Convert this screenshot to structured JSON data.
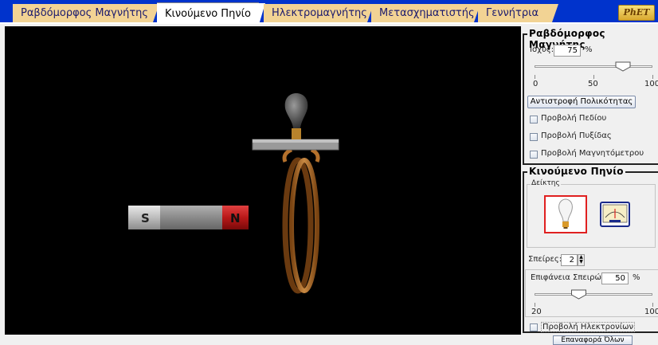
{
  "tabs": [
    {
      "label": "Ραβδόμορφος Μαγνήτης",
      "selected": false
    },
    {
      "label": "Κινούμενο Πηνίο",
      "selected": true
    },
    {
      "label": "Ηλεκτρομαγνήτης",
      "selected": false
    },
    {
      "label": "Μετασχηματιστής",
      "selected": false
    },
    {
      "label": "Γεννήτρια",
      "selected": false
    }
  ],
  "logo": {
    "text": "PhET"
  },
  "magnet": {
    "south_label": "S",
    "north_label": "N"
  },
  "bar_magnet_panel": {
    "title": "Ραβδόμορφος Μαγνήτης",
    "strength_label": "Ισχύς:",
    "strength_value": "75",
    "strength_unit": "%",
    "strength_fraction": 0.75,
    "scale_min": "0",
    "scale_mid": "50",
    "scale_max": "100",
    "flip_button": "Αντιστροφή Πολικότητας",
    "show_field": "Προβολή Πεδίου",
    "show_compass": "Προβολή Πυξίδας",
    "show_meter": "Προβολή Μαγνητόμετρου"
  },
  "pickup_coil_panel": {
    "title": "Κινούμενο Πηνίο",
    "indicator_label": "Δείκτης",
    "loops_label": "Σπείρες:",
    "loops_value": "2",
    "area_label": "Επιφάνεια Σπειρών:",
    "area_value": "50",
    "area_unit": "%",
    "area_fraction": 0.375,
    "area_min": "20",
    "area_max": "100",
    "show_electrons": "Προβολή Ηλεκτρονίων"
  },
  "bottom": {
    "reset_button": "Επαναφορά Όλων"
  },
  "colors": {
    "accent_blue": "#0033cc",
    "tab_bg": "#f2d394",
    "selected_indicator": "#e02020",
    "coil": "#b4712c"
  }
}
